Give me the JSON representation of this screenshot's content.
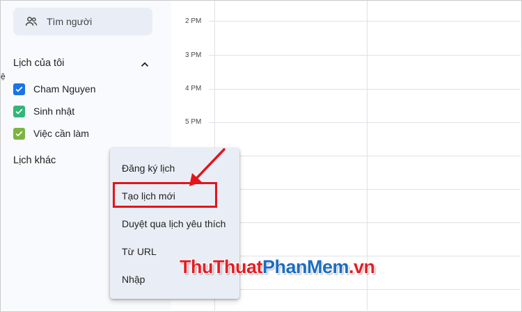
{
  "colors": {
    "accent_blue": "#1a73e8",
    "green_birthday": "#33b679",
    "green_tasks": "#7cb342",
    "highlight_red": "#e3151a"
  },
  "sidebar": {
    "search_people": {
      "icon": "people-icon",
      "label": "Tìm người"
    },
    "my_calendars": {
      "title": "Lịch của tôi",
      "toggle_icon": "chevron-up-icon",
      "items": [
        {
          "label": "Cham Nguyen",
          "checked": true,
          "color": "#1a73e8"
        },
        {
          "label": "Sinh nhật",
          "checked": true,
          "color": "#33b679"
        },
        {
          "label": "Việc cần làm",
          "checked": true,
          "color": "#7cb342"
        }
      ]
    },
    "stray_glyph": "ệ",
    "other_calendars": {
      "title": "Lịch khác"
    }
  },
  "grid": {
    "time_labels": [
      "2 PM",
      "3 PM",
      "4 PM",
      "5 PM"
    ]
  },
  "menu": {
    "items": [
      {
        "label": "Đăng ký lịch"
      },
      {
        "label": "Tạo lịch mới",
        "highlighted": true
      },
      {
        "label": "Duyệt qua lịch yêu thích"
      },
      {
        "label": "Từ URL"
      },
      {
        "label": "Nhập"
      }
    ]
  },
  "watermark": {
    "part1": "ThuThuat",
    "part2": "PhanMem",
    "part3": ".vn"
  }
}
